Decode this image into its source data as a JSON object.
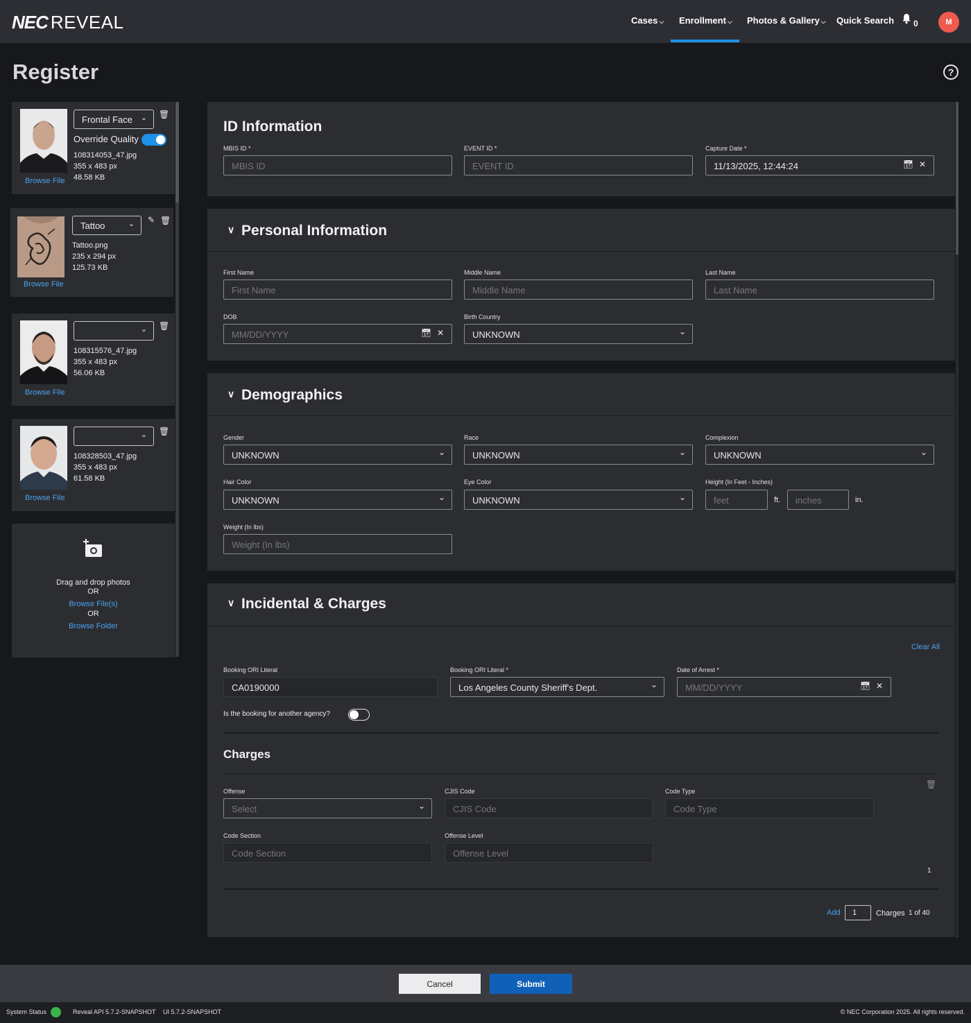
{
  "app": {
    "logo_bold": "NEC",
    "logo_text": "REVEAL"
  },
  "nav": {
    "items": [
      {
        "label": "Cases",
        "chevron": "⌵"
      },
      {
        "label": "Enrollment",
        "chevron": "⌵"
      },
      {
        "label": "Photos & Gallery",
        "chevron": "⌵"
      },
      {
        "label": "Quick Search"
      }
    ],
    "active": "Enrollment",
    "notification_count": "0",
    "avatar_initial": "M"
  },
  "page": {
    "title": "Register",
    "help": "?"
  },
  "photos": [
    {
      "type": "Frontal Face",
      "override_quality_label": "Override Quality",
      "override_quality": true,
      "filename": "108314053_47.jpg",
      "dimensions": "355 x 483 px",
      "size": "48.58 KB",
      "browse": "Browse File"
    },
    {
      "type": "Tattoo",
      "filename": "Tattoo.png",
      "dimensions": "235 x 294 px",
      "size": "125.73 KB",
      "browse": "Browse File"
    },
    {
      "type": "",
      "filename": "108315576_47.jpg",
      "dimensions": "355 x 483 px",
      "size": "56.06 KB",
      "browse": "Browse File"
    },
    {
      "type": "",
      "filename": "108328503_47.jpg",
      "dimensions": "355 x 483 px",
      "size": "61.58 KB",
      "browse": "Browse File"
    }
  ],
  "dropzone": {
    "text": "Drag and drop photos",
    "or1": "OR",
    "browse_files": "Browse File(s)",
    "or2": "OR",
    "browse_folder": "Browse Folder"
  },
  "id_info": {
    "title": "ID Information",
    "mbis_label": "MBIS ID *",
    "mbis_placeholder": "MBIS ID",
    "event_label": "EVENT ID *",
    "event_placeholder": "EVENT ID",
    "capture_label": "Capture Date *",
    "capture_value": "11/13/2025, 12:44:24"
  },
  "personal": {
    "title": "Personal Information",
    "first_label": "First Name",
    "first_placeholder": "First Name",
    "middle_label": "Middle Name",
    "middle_placeholder": "Middle Name",
    "last_label": "Last Name",
    "last_placeholder": "Last Name",
    "dob_label": "DOB",
    "dob_placeholder": "MM/DD/YYYY",
    "country_label": "Birth Country",
    "country_value": "UNKNOWN"
  },
  "demographics": {
    "title": "Demographics",
    "gender_label": "Gender",
    "gender_value": "UNKNOWN",
    "race_label": "Race",
    "race_value": "UNKNOWN",
    "complexion_label": "Complexion",
    "complexion_value": "UNKNOWN",
    "hair_label": "Hair Color",
    "hair_value": "UNKNOWN",
    "eye_label": "Eye Color",
    "eye_value": "UNKNOWN",
    "height_label": "Height (In Feet - Inches)",
    "feet_placeholder": "feet",
    "feet_unit": "ft.",
    "inches_placeholder": "inches",
    "inches_unit": "in.",
    "weight_label": "Weight (In lbs)",
    "weight_placeholder": "Weight (In lbs)"
  },
  "incidental": {
    "title": "Incidental & Charges",
    "clear_all": "Clear All",
    "ori1_label": "Booking ORI Literal",
    "ori1_value": "CA0190000",
    "ori2_label": "Booking ORI Literal *",
    "ori2_value": "Los Angeles County Sheriff's Dept.",
    "arrest_label": "Date of Arrest *",
    "arrest_placeholder": "MM/DD/YYYY",
    "other_agency_label": "Is the booking for another agency?",
    "other_agency": false,
    "charges_title": "Charges",
    "offense_label": "Offense",
    "offense_placeholder": "Select",
    "cjis_label": "CJIS Code",
    "cjis_placeholder": "CJIS Code",
    "codetype_label": "Code Type",
    "codetype_placeholder": "Code Type",
    "codesection_label": "Code Section",
    "codesection_placeholder": "Code Section",
    "offlevel_label": "Offense Level",
    "offlevel_placeholder": "Offense Level",
    "charge_index": "1",
    "add_label": "Add",
    "add_count": "1",
    "charges_label": "Charges",
    "charges_count": "1 of 40"
  },
  "actions": {
    "cancel": "Cancel",
    "submit": "Submit"
  },
  "status": {
    "system_status": "System Status",
    "status_color": "#3cb44b",
    "api_version": "Reveal API 5.7.2-SNAPSHOT",
    "ui_version": "UI 5.7.2-SNAPSHOT",
    "copyright": "© NEC Corporation 2025. All rights reserved."
  },
  "colors": {
    "accent": "#1e90e8",
    "link": "#4aa3ee",
    "submit": "#1160b8",
    "avatar": "#ee5a4e"
  },
  "icons": {
    "bell": "bell-icon",
    "help": "help-icon",
    "calendar": "calendar-icon",
    "clear": "close-icon",
    "trash": "trash-icon",
    "edit": "pencil-icon",
    "add_photo": "add-photo-icon",
    "chevron": "chevron-down-icon"
  }
}
